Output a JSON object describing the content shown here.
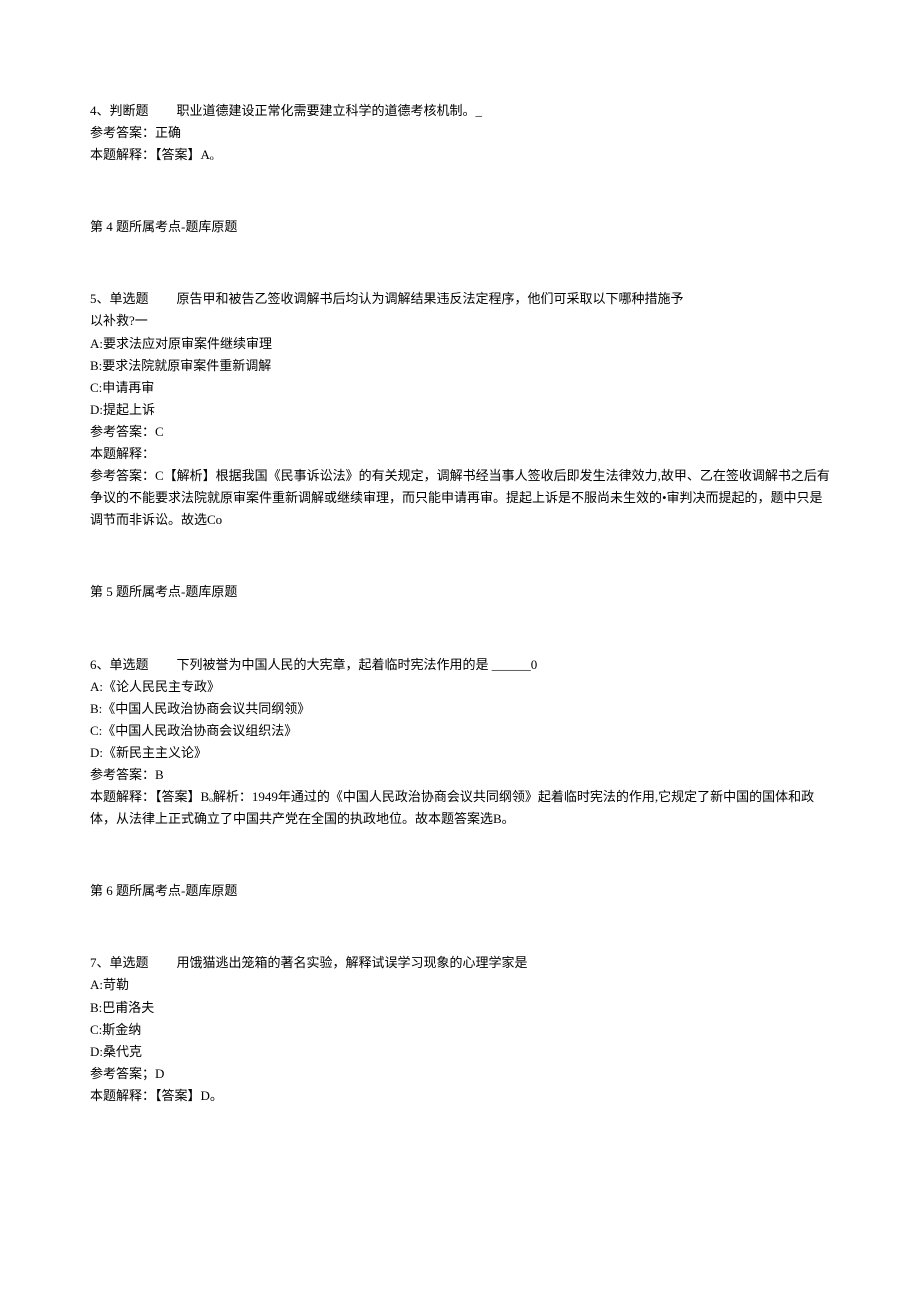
{
  "q4": {
    "number": "4、判断题",
    "stem": "职业道德建设正常化需要建立科学的道德考核机制。_",
    "ref_label": "参考答案：",
    "ref_answer": "正确",
    "explain_label": "本题解释：",
    "explain_text": "【答案】Aₒ",
    "topic": "第 4 题所属考点-题库原题"
  },
  "q5": {
    "number": "5、单选题",
    "stem1": "原告甲和被告乙签收调解书后均认为调解结果违反法定程序，他们可采取以下哪种措施予",
    "stem2": "以补救?一",
    "optA": "A:要求法应对原审案件继续审理",
    "optB": "B:要求法院就原审案件重新调解",
    "optC": "C:申请再审",
    "optD": "D:提起上诉",
    "ref_label": "参考答案：",
    "ref_answer": "C",
    "explain_label": "本题解释：",
    "explain1": "参考答案：C【解析】根据我国《民事诉讼法》的有关规定，调解书经当事人签收后即发生法律效力,故甲、乙在签收调解书之后有争议的不能要求法院就原审案件重新调解或继续审理，而只能申请再审。提起上诉是不服尚未生效的•审判决而提起的，题中只是调节而非诉讼。故选Co",
    "topic": "第 5 题所属考点-题库原题"
  },
  "q6": {
    "number": "6、单选题",
    "stem": "下列被誉为中国人民的大宪章，起着临时宪法作用的是  ______0",
    "optA": "A:《论人民民主专政》",
    "optB": "B:《中国人民政治协商会议共同纲领》",
    "optC": "C:《中国人民政治协商会议组织法》",
    "optD": "D:《新民主主义论》",
    "ref_label": "参考答案：",
    "ref_answer": "B",
    "explain_label": "本题解释：",
    "explain_text": "【答案】Bₒ解析：1949年通过的《中国人民政治协商会议共同纲领》起着临时宪法的作用,它规定了新中国的国体和政体，从法律上正式确立了中国共产党在全国的执政地位。故本题答案选B。",
    "topic": "第 6 题所属考点-题库原题"
  },
  "q7": {
    "number": "7、单选题",
    "stem": "用饿猫逃出笼箱的著名实验，解释试误学习现象的心理学家是",
    "optA": "A:苛勒",
    "optB": "B:巴甫洛夫",
    "optC": "C:斯金纳",
    "optD": "D:桑代克",
    "ref_label": "参考答案；",
    "ref_answer": "D",
    "explain_label": "本题解释：",
    "explain_text": "【答案】D。"
  }
}
